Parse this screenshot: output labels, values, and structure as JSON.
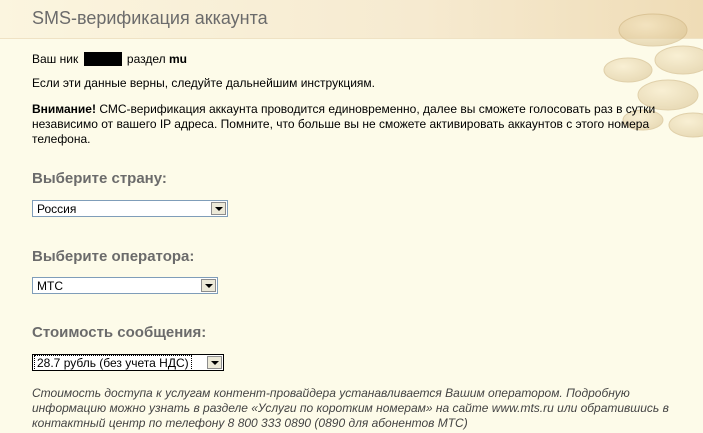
{
  "title": "SMS-верификация аккаунта",
  "nick": {
    "prefix": "Ваш ник",
    "section_label": "раздел",
    "section": "mu"
  },
  "info_text": "Если эти данные верны, следуйте дальнейшим инструкциям.",
  "warning": {
    "label": "Внимание!",
    "text": "СМС-верификация аккаунта проводится единовременно, далее вы сможете голосовать раз в сутки независимо от вашего IP адреса. Помните, что больше вы не сможете активировать аккаунтов с этого номера телефона."
  },
  "country": {
    "label": "Выберите страну:",
    "selected": "Россия"
  },
  "operator": {
    "label": "Выберите оператора:",
    "selected": "МТС"
  },
  "cost": {
    "label": "Стоимость сообщения:",
    "selected": "28.7 рубль (без учета НДС)"
  },
  "note": "Стоимость доступа к услугам контент-провайдера устанавливается Вашим оператором. Подробную информацию можно узнать в разделе «Услуги по коротким номерам» на сайте www.mts.ru или обратившись в контактный центр по телефону 8 800 333 0890 (0890 для абонентов МТС)",
  "colors": {
    "background": "#fdfbe9",
    "label": "#6b6b6b",
    "note": "#444444"
  }
}
